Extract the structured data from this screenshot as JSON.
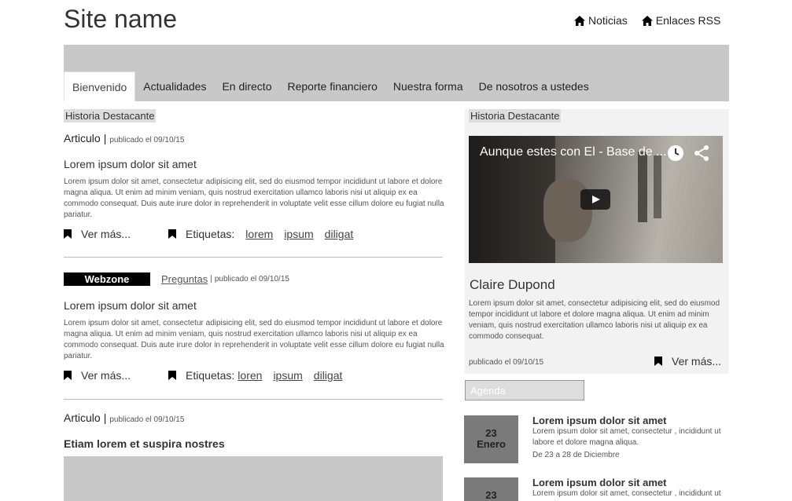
{
  "header": {
    "site_name": "Site name",
    "links": [
      {
        "label": "Noticias",
        "icon": "home-icon"
      },
      {
        "label": "Enlaces RSS",
        "icon": "home-icon"
      }
    ]
  },
  "nav": {
    "tabs": [
      {
        "label": "Bienvenido",
        "active": true
      },
      {
        "label": "Actualidades",
        "active": false
      },
      {
        "label": "En directo",
        "active": false
      },
      {
        "label": "Reporte financiero",
        "active": false
      },
      {
        "label": "Nuestra forma",
        "active": false
      },
      {
        "label": "De nosotros a ustedes",
        "active": false
      }
    ]
  },
  "main": {
    "section_label": "Historia Destacante",
    "articles": [
      {
        "type": "Articulo",
        "sep": "|",
        "meta": "publicado el 09/10/15",
        "title": "Lorem ipsum dolor sit amet",
        "body": "Lorem ipsum dolor sit amet, consectetur adipisicing elit, sed do eiusmod tempor incididunt ut labore et dolore magna aliqua. Ut enim ad minim veniam, quis nostrud exercitation ullamco laboris nisi ut aliquip ex ea commodo consequat. Duis aute irure dolor in reprehenderit in voluptate velit esse cillum dolore eu fugiat nulla pariatur.",
        "more": "Ver más...",
        "tags_label": "Etiquetas:",
        "tags": [
          "lorem",
          "ipsum",
          "diligat"
        ]
      },
      {
        "badge": "Webzone",
        "type": "Preguntas",
        "sep": "|",
        "meta": "publicado el 09/10/15",
        "title": "Lorem ipsum dolor sit amet",
        "body": "Lorem ipsum dolor sit amet, consectetur adipisicing elit, sed do eiusmod tempor incididunt ut labore et dolore magna aliqua. Ut enim ad minim veniam, quis nostrud exercitation ullamco laboris nisi ut aliquip ex ea commodo consequat. Duis aute irure dolor in reprehenderit in voluptate velit esse cillum dolore eu fugiat nulla pariatur.",
        "more": "Ver más...",
        "tags_label": "Etiquetas:",
        "tags": [
          "loren",
          "ipsum",
          "diligat"
        ]
      },
      {
        "type": "Articulo",
        "sep": "|",
        "meta": "publicado el 09/10/15",
        "title": "Etiam lorem et suspira nostres"
      }
    ]
  },
  "sidebar": {
    "section_label": "Historia Destacante",
    "video": {
      "title": "Aunque estes con El - Base de ..."
    },
    "person_name": "Claire Dupond",
    "person_body": "Lorem ipsum dolor sit amet, consectetur adipisicing elit, sed do eiusmod tempor incididunt ut labore et dolore magna aliqua. Ut enim ad minim veniam, quis nostrud exercitation ullamco laboris nisi ut aliquip ex ea commodo consequat.",
    "person_meta": "publicado el 09/10/15",
    "more": "Ver más...",
    "agenda_label": "Agenda",
    "events": [
      {
        "day": "23",
        "month": "Enero",
        "title": "Lorem ipsum dolor sit amet",
        "body": "Lorem ipsum dolor sit amet, consectetur , incididunt ut labore et dolore magna aliqua.",
        "range": "De 23 a 28 de Diciembre"
      },
      {
        "day": "23",
        "month": "",
        "title": "Lorem ipsum dolor sit amet",
        "body": "Lorem ipsum dolor sit amet, consectetur , incididunt ut"
      }
    ]
  }
}
